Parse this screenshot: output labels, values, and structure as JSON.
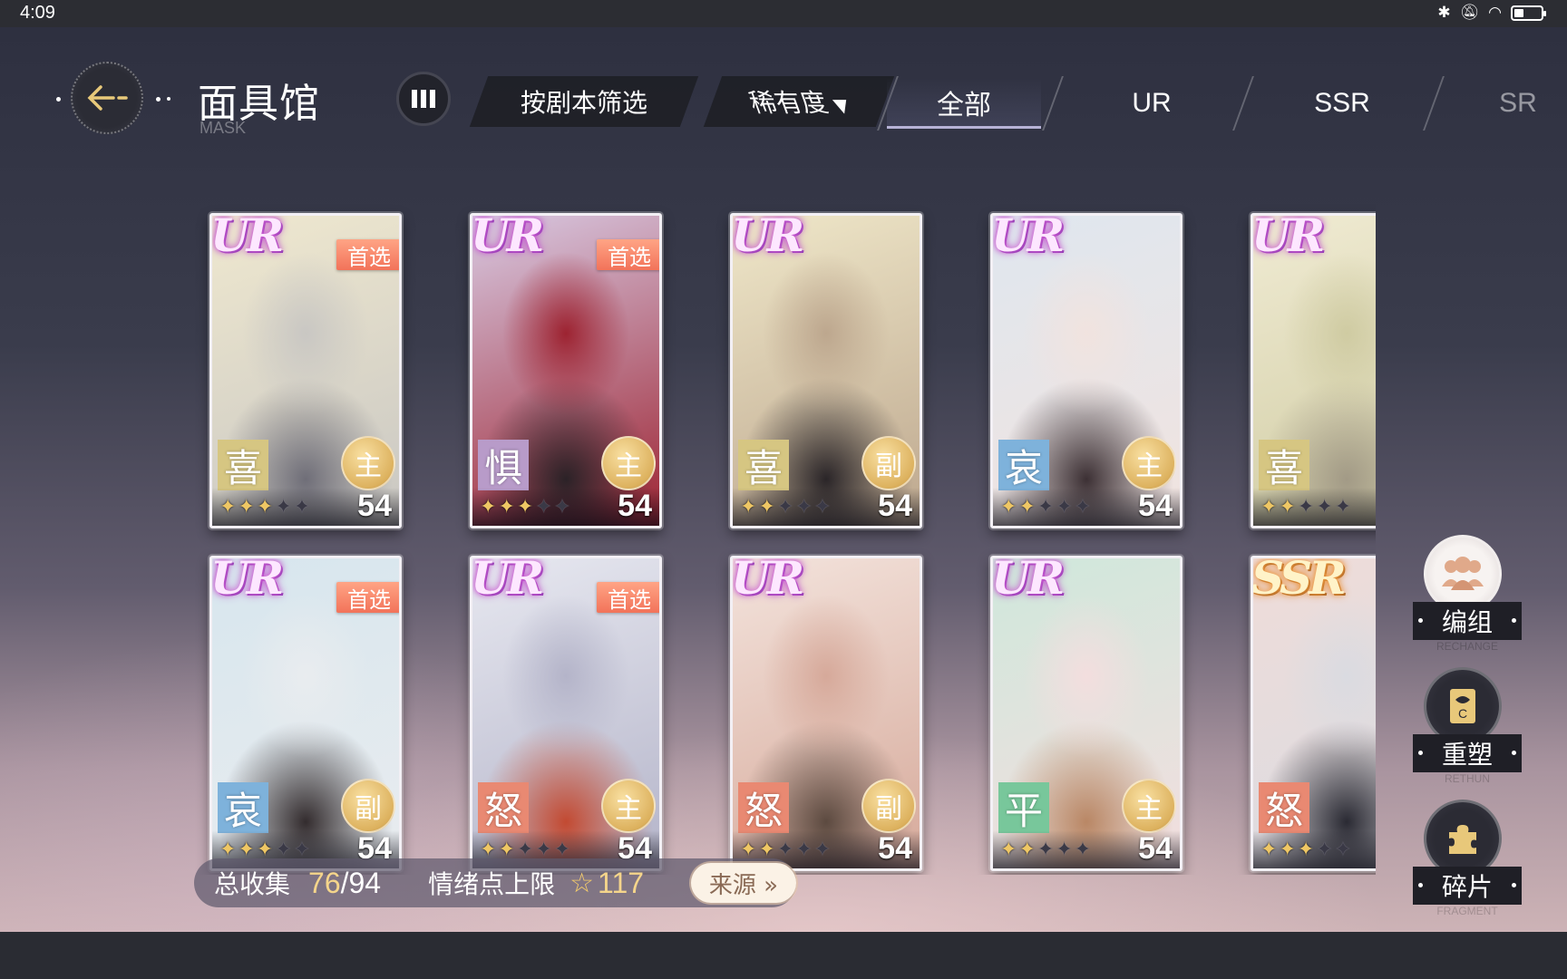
{
  "status": {
    "time": "4:09",
    "battery_level": 0.35,
    "icons": [
      "bluetooth-icon",
      "mute-icon",
      "wifi-icon",
      "battery-icon"
    ]
  },
  "header": {
    "title": "面具馆",
    "subtitle": "MASK",
    "filter_script": "按剧本筛选",
    "filter_rarity": "稀有度",
    "tabs": [
      "全部",
      "UR",
      "SSR",
      "SR"
    ],
    "active_tab": "全部"
  },
  "cards": [
    {
      "rarity": "UR",
      "preferred": "首选",
      "emotion": "喜",
      "role": "主",
      "stars": 3,
      "level": "54",
      "palette": [
        "#efe8cf",
        "#c9c7c3",
        "#6f6e78"
      ],
      "emotion_color": "#d6c682"
    },
    {
      "rarity": "UR",
      "preferred": "首选",
      "emotion": "惧",
      "role": "主",
      "stars": 3,
      "level": "54",
      "palette": [
        "#d8c9e2",
        "#9d2331",
        "#2b2227"
      ],
      "emotion_color": "#b89bc9"
    },
    {
      "rarity": "UR",
      "preferred": "",
      "emotion": "喜",
      "role": "副",
      "stars": 2,
      "level": "54",
      "palette": [
        "#efe7c9",
        "#bda78e",
        "#2a2528"
      ],
      "emotion_color": "#d6c682"
    },
    {
      "rarity": "UR",
      "preferred": "",
      "emotion": "哀",
      "role": "主",
      "stars": 2,
      "level": "54",
      "palette": [
        "#dfe7ef",
        "#f1e3df",
        "#3c3034"
      ],
      "emotion_color": "#7eb2db"
    },
    {
      "rarity": "UR",
      "preferred": "",
      "emotion": "喜",
      "role": "",
      "stars": 2,
      "level": "",
      "palette": [
        "#f0ebd3",
        "#cfcba2",
        "#a29a86"
      ],
      "emotion_color": "#d6c682"
    },
    {
      "rarity": "UR",
      "preferred": "首选",
      "emotion": "哀",
      "role": "副",
      "stars": 3,
      "level": "54",
      "palette": [
        "#d7e6ee",
        "#e9ecef",
        "#332c2e"
      ],
      "emotion_color": "#7eb2db"
    },
    {
      "rarity": "UR",
      "preferred": "首选",
      "emotion": "怒",
      "role": "主",
      "stars": 2,
      "level": "54",
      "palette": [
        "#e7e8f0",
        "#b4b4c9",
        "#c24a32"
      ],
      "emotion_color": "#e98972"
    },
    {
      "rarity": "UR",
      "preferred": "",
      "emotion": "怒",
      "role": "副",
      "stars": 2,
      "level": "54",
      "palette": [
        "#f3e3dc",
        "#d6a99a",
        "#5c4a40"
      ],
      "emotion_color": "#e98972"
    },
    {
      "rarity": "UR",
      "preferred": "",
      "emotion": "平",
      "role": "主",
      "stars": 2,
      "level": "54",
      "palette": [
        "#cfe8dc",
        "#f3dede",
        "#b98765"
      ],
      "emotion_color": "#78c79b"
    },
    {
      "rarity": "SSR",
      "preferred": "",
      "emotion": "怒",
      "role": "",
      "stars": 3,
      "level": "",
      "palette": [
        "#efdcd9",
        "#dadbe1",
        "#2a2a33"
      ],
      "emotion_color": "#e98972"
    }
  ],
  "info": {
    "total_label": "总收集",
    "collected": "76",
    "total": "/94",
    "cap_label": "情绪点上限",
    "cap_value": "117",
    "source_label": "来源 »"
  },
  "side": [
    {
      "label": "编组",
      "en": "RECHANGE",
      "icon": "group-icon"
    },
    {
      "label": "重塑",
      "en": "RETHUN",
      "icon": "reshape-icon"
    },
    {
      "label": "碎片",
      "en": "FRAGMENT",
      "icon": "puzzle-icon"
    }
  ]
}
